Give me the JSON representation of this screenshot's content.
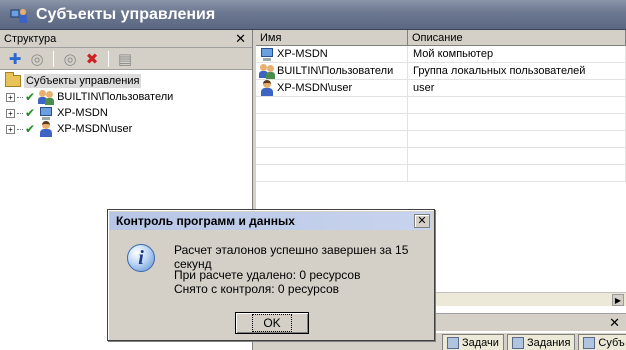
{
  "window": {
    "title": "Субъекты управления"
  },
  "left_pane": {
    "header": "Структура",
    "close": "✕",
    "toolbar": {
      "add_icon": "plus-icon",
      "remove_icon": "x-icon",
      "folder_icon": "folder-icon"
    },
    "root": "Субъекты управления",
    "items": [
      {
        "label": "BUILTIN\\Пользователи",
        "icon": "group-icon"
      },
      {
        "label": "XP-MSDN",
        "icon": "computer-icon"
      },
      {
        "label": "XP-MSDN\\user",
        "icon": "user-icon"
      }
    ]
  },
  "grid": {
    "columns": [
      "Имя",
      "Описание"
    ],
    "rows": [
      {
        "name": "XP-MSDN",
        "desc": "Мой компьютер",
        "icon": "computer-icon"
      },
      {
        "name": "BUILTIN\\Пользователи",
        "desc": "Группа локальных пользователей",
        "icon": "group-icon"
      },
      {
        "name": "XP-MSDN\\user",
        "desc": "user",
        "icon": "user-icon"
      }
    ]
  },
  "bottom": {
    "close": "✕",
    "tabs": [
      "Задачи",
      "Задания",
      "Субъ"
    ]
  },
  "dialog": {
    "title": "Контроль программ и данных",
    "close": "✕",
    "message1": "Расчет эталонов успешно завершен за 15 секунд",
    "message2": "При расчете удалено: 0 ресурсов",
    "message3": "Снято с контроля: 0 ресурсов",
    "ok_label": "OK"
  }
}
